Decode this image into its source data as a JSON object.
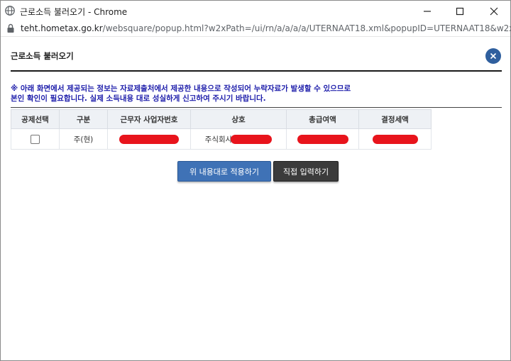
{
  "window": {
    "title": "근로소득 불러오기 - Chrome",
    "url_host": "teht.hometax.go.kr",
    "url_path": "/websquare/popup.html?w2xPath=/ui/rn/a/a/a/a/UTERNAAT18.xml&popupID=UTERNAAT18&w2x..."
  },
  "popup": {
    "title": "근로소득 불러오기",
    "notice_line1": "※ 아래 화면에서 제공되는 정보는 자료제출처에서 제공한 내용으로 작성되어 누락자료가 발생할 수 있으므로",
    "notice_line2": "본인 확인이 필요합니다. 실제 소득내용 대로 성실하게 신고하여 주시기 바랍니다."
  },
  "table": {
    "headers": [
      "공제선택",
      "구분",
      "근무자 사업자번호",
      "상호",
      "총급여액",
      "결정세액"
    ],
    "rows": [
      {
        "checked": false,
        "category": "주(현)",
        "company_prefix": "주식회사"
      }
    ]
  },
  "buttons": {
    "apply": "위 내용대로 적용하기",
    "direct": "직접 입력하기"
  },
  "colors": {
    "accent": "#3f72b6",
    "notice": "#1c1caa",
    "redaction": "#e8141c"
  }
}
